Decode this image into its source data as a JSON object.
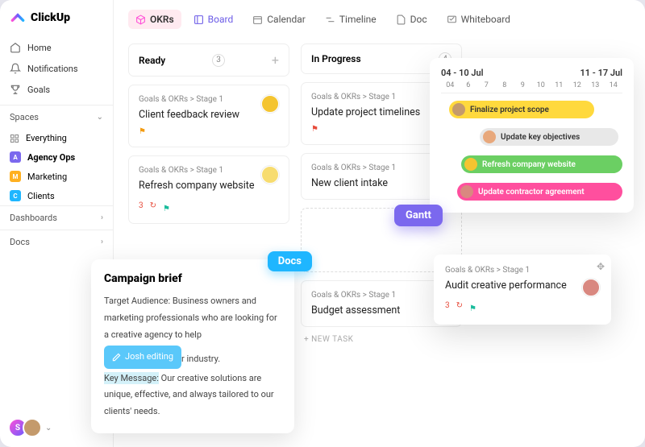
{
  "brand": "ClickUp",
  "sidebar": {
    "nav": [
      {
        "label": "Home"
      },
      {
        "label": "Notifications"
      },
      {
        "label": "Goals"
      }
    ],
    "spaces_header": "Spaces",
    "everything": "Everything",
    "spaces": [
      {
        "letter": "A",
        "label": "Agency Ops",
        "color": "#7b68ee",
        "active": true
      },
      {
        "letter": "M",
        "label": "Marketing",
        "color": "#ffb020"
      },
      {
        "letter": "C",
        "label": "Clients",
        "color": "#1fb6ff"
      }
    ],
    "dashboards": "Dashboards",
    "docs": "Docs"
  },
  "tabs": [
    {
      "label": "OKRs"
    },
    {
      "label": "Board"
    },
    {
      "label": "Calendar"
    },
    {
      "label": "Timeline"
    },
    {
      "label": "Doc"
    },
    {
      "label": "Whiteboard"
    }
  ],
  "board": {
    "columns": [
      {
        "name": "Ready",
        "count": "3",
        "cards": [
          {
            "bc": "Goals & OKRs > Stage 1",
            "title": "Client feedback review",
            "flag": "orng"
          },
          {
            "bc": "Goals & OKRs > Stage 1",
            "title": "Refresh company website",
            "meta": "3",
            "flag": "teal"
          }
        ]
      },
      {
        "name": "In Progress",
        "count": "4",
        "cards": [
          {
            "bc": "Goals & OKRs > Stage 1",
            "title": "Update project timelines",
            "flag": "red"
          },
          {
            "bc": "Goals & OKRs > Stage 1",
            "title": "New client intake"
          },
          {
            "bc": "Goals & OKRs > Stage 1",
            "title": "Budget assessment"
          }
        ],
        "new_task": "+ NEW TASK"
      }
    ]
  },
  "docs": {
    "badge": "Docs",
    "title": "Campaign brief",
    "body_1": "Target Audience: Business owners and marketing professionals who are looking for a creative agency to help ",
    "editing": "Josh editing",
    "body_1b": "r industry.",
    "body_2a": "Key Message:",
    "body_2b": " Our creative solutions are unique, effective, and always tailored to our clients' needs."
  },
  "gantt": {
    "badge": "Gantt",
    "ranges": [
      "04 - 10 Jul",
      "11 - 17 Jul"
    ],
    "days": [
      "04",
      "6",
      "7",
      "8",
      "9",
      "10",
      "11",
      "12",
      "13",
      "14"
    ],
    "bars": [
      {
        "label": "Finalize project scope",
        "cls": "g-yellow"
      },
      {
        "label": "Update key objectives",
        "cls": "g-gray"
      },
      {
        "label": "Refresh company website",
        "cls": "g-green"
      },
      {
        "label": "Update contractor agreement",
        "cls": "g-pink"
      }
    ]
  },
  "float_card": {
    "bc": "Goals & OKRs > Stage 1",
    "title": "Audit creative performance",
    "meta": "3"
  }
}
